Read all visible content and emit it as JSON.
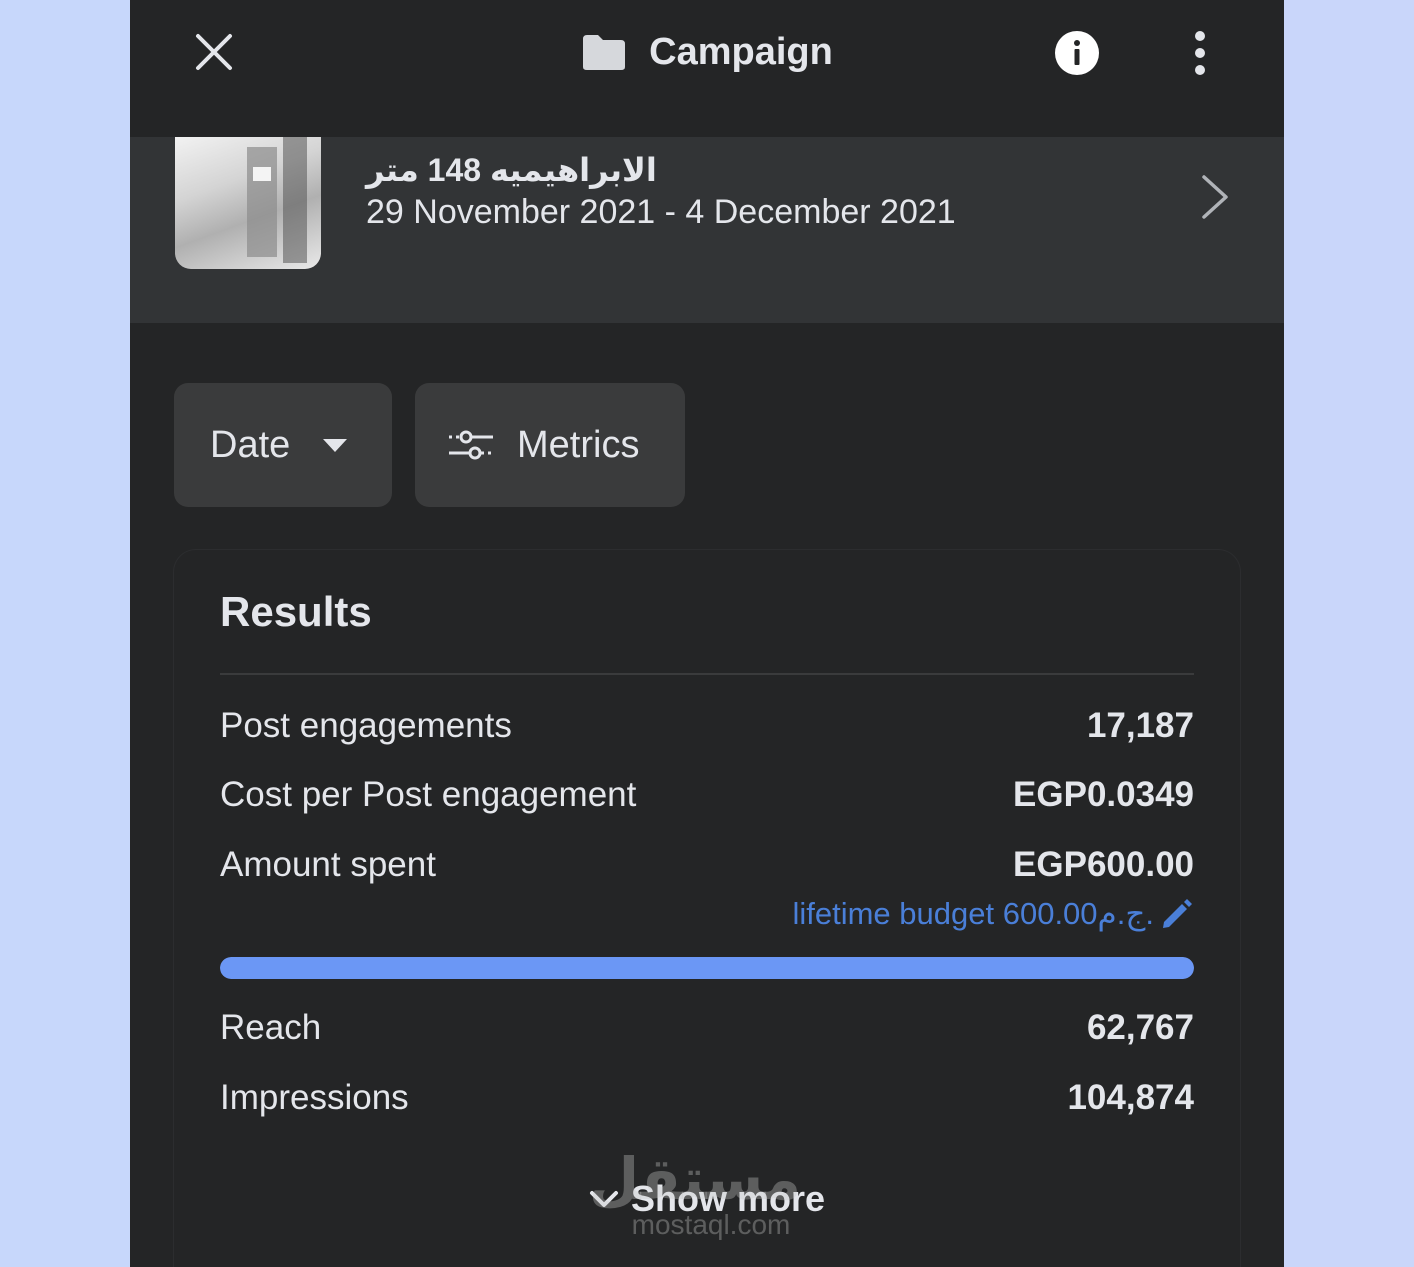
{
  "header": {
    "title": "Campaign",
    "icons": [
      "close-icon",
      "folder-icon",
      "info-icon",
      "more-vertical-icon"
    ]
  },
  "campaign": {
    "name": "الابراهيميه 148 متر",
    "dates": "29 November 2021 - 4 December 2021"
  },
  "filters": {
    "date_label": "Date",
    "metrics_label": "Metrics"
  },
  "results": {
    "title": "Results",
    "rows": [
      {
        "label": "Post engagements",
        "value": "17,187"
      },
      {
        "label": "Cost per Post engagement",
        "value": "EGP0.0349"
      },
      {
        "label": "Amount spent",
        "value": "EGP600.00"
      }
    ],
    "budget_text": "lifetime budget 600.00ج.م.",
    "budget_progress": 1.0,
    "rows2": [
      {
        "label": "Reach",
        "value": "62,767"
      },
      {
        "label": "Impressions",
        "value": "104,874"
      }
    ],
    "show_more": "Show more"
  },
  "watermark": {
    "logo": "مستقل",
    "url": "mostaql.com"
  },
  "colors": {
    "background": "#c7d7fb",
    "panel": "#242526",
    "accent": "#6b97f5",
    "link": "#4a7fd8"
  }
}
